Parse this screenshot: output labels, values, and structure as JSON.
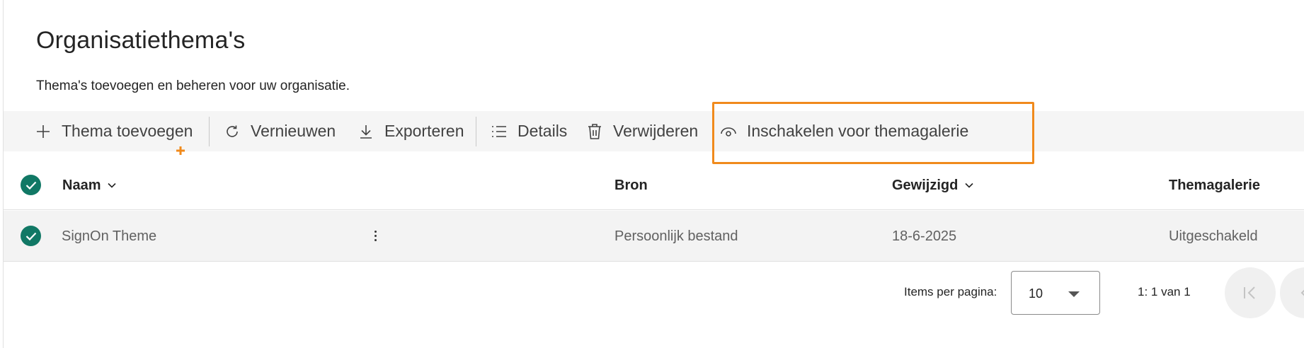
{
  "page": {
    "title": "Organisatiethema's",
    "subtitle": "Thema's toevoegen en beheren voor uw organisatie."
  },
  "toolbar": {
    "add_label": "Thema toevoegen",
    "refresh_label": "Vernieuwen",
    "export_label": "Exporteren",
    "details_label": "Details",
    "delete_label": "Verwijderen",
    "gallery_label": "Inschakelen voor themagalerie"
  },
  "table": {
    "columns": {
      "name": "Naam",
      "source": "Bron",
      "modified": "Gewijzigd",
      "gallery": "Themagalerie"
    },
    "rows": [
      {
        "name": "SignOn Theme",
        "source": "Persoonlijk bestand",
        "modified": "18-6-2025",
        "gallery": "Uitgeschakeld"
      }
    ]
  },
  "pagination": {
    "items_per_page_label": "Items per pagina:",
    "items_per_page_value": "10",
    "range_text": "1: 1 van 1"
  },
  "colors": {
    "accent_check": "#117865",
    "highlight": "#f08a1c",
    "toolbar_bg": "#f5f5f5"
  }
}
